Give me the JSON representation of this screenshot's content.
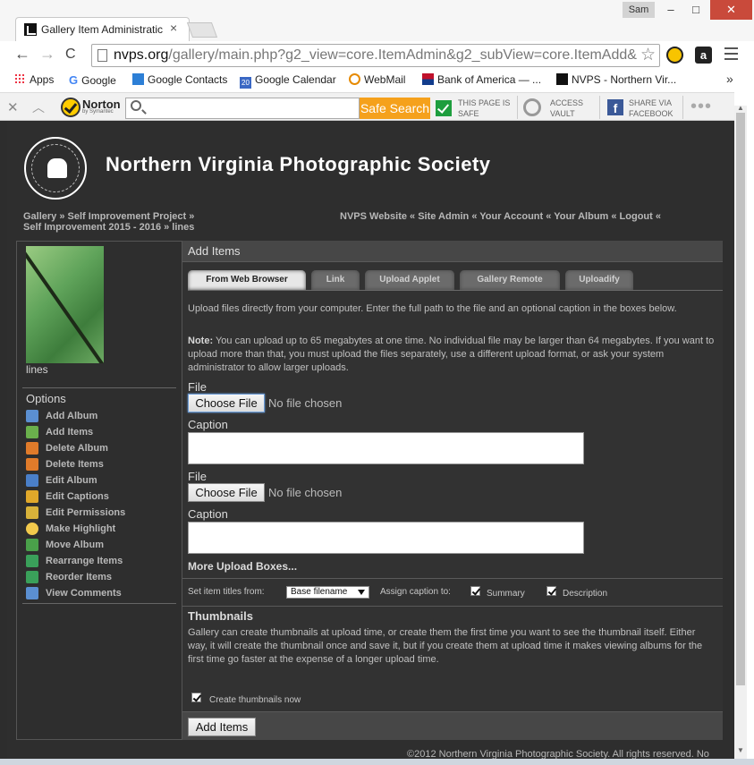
{
  "browser": {
    "tab_title": "Gallery Item Administratic",
    "tab_close": "×",
    "user_name": "Sam",
    "window_minimize": "–",
    "window_maximize": "□",
    "window_close": "✕",
    "url_host": "nvps.org",
    "url_path": "/gallery/main.php?g2_view=core.ItemAdmin&g2_subView=core.ItemAdd&",
    "nav_back": "←",
    "nav_forward": "→",
    "nav_reload": "C",
    "star": "☆",
    "amazon_badge": "a",
    "bookmarks_more": "»",
    "bookmarks": [
      {
        "label": "Apps"
      },
      {
        "label": "Google"
      },
      {
        "label": "Google Contacts"
      },
      {
        "label": "Google Calendar",
        "badge": "20"
      },
      {
        "label": "WebMail"
      },
      {
        "label": "Bank of America — ..."
      },
      {
        "label": "NVPS - Northern Vir..."
      }
    ]
  },
  "norton": {
    "close": "✕",
    "up": "︿",
    "brand": "Norton",
    "brand_sub": "by Symantec",
    "search_button": "Safe Search",
    "page_safe_line1": "THIS PAGE IS",
    "page_safe_line2": "SAFE",
    "vault_line1": "ACCESS",
    "vault_line2": "VAULT",
    "share_line1": "SHARE VIA",
    "share_line2": "FACEBOOK",
    "fb_letter": "f",
    "more": "•••"
  },
  "site": {
    "title": "Northern Virginia Photographic Society",
    "breadcrumb_line1": "Gallery » Self Improvement Project »",
    "breadcrumb_line2": "Self Improvement 2015 - 2016 » lines",
    "top_links": "NVPS Website « Site Admin « Your Account « Your Album « Logout «",
    "copyright": "©2012 Northern Virginia Photographic Society. All rights reserved. No"
  },
  "sidebar": {
    "item_caption": "lines",
    "options_title": "Options",
    "options": [
      {
        "label": "Add Album",
        "color": "#5b8fd1"
      },
      {
        "label": "Add Items",
        "color": "#6ab04c"
      },
      {
        "label": "Delete Album",
        "color": "#e07b2a"
      },
      {
        "label": "Delete Items",
        "color": "#e07b2a"
      },
      {
        "label": "Edit Album",
        "color": "#4a7fc8"
      },
      {
        "label": "Edit Captions",
        "color": "#e0a82a"
      },
      {
        "label": "Edit Permissions",
        "color": "#d8b23a"
      },
      {
        "label": "Make Highlight",
        "color": "#f2c94c"
      },
      {
        "label": "Move Album",
        "color": "#4aa04a"
      },
      {
        "label": "Rearrange Items",
        "color": "#3aa05a"
      },
      {
        "label": "Reorder Items",
        "color": "#3aa05a"
      },
      {
        "label": "View Comments",
        "color": "#5b8fd1"
      }
    ]
  },
  "main": {
    "header": "Add Items",
    "tabs": [
      "From Web Browser",
      "Link",
      "Upload Applet",
      "Gallery Remote",
      "Uploadify"
    ],
    "intro": "Upload files directly from your computer. Enter the full path to the file and an optional caption in the boxes below.",
    "note_label": "Note:",
    "note": "You can upload up to 65 megabytes at one time. No individual file may be larger than 64 megabytes. If you want to upload more than that, you must upload the files separately, use a different upload format, or ask your system administrator to allow larger uploads.",
    "file_label": "File",
    "choose_file": "Choose File",
    "no_file": "No file chosen",
    "caption_label": "Caption",
    "more_boxes": "More Upload Boxes...",
    "set_titles_label": "Set item titles from:",
    "title_source": "Base filename",
    "assign_caption_label": "Assign caption to:",
    "summary_label": "Summary",
    "description_label": "Description",
    "thumbnails_title": "Thumbnails",
    "thumbnails_text": "Gallery can create thumbnails at upload time, or create them the first time you want to see the thumbnail itself. Either way, it will create the thumbnail once and save it, but if you create them at upload time it makes viewing albums for the first time go faster at the expense of a longer upload time.",
    "create_thumbs_label": "Create thumbnails now",
    "submit": "Add Items"
  }
}
